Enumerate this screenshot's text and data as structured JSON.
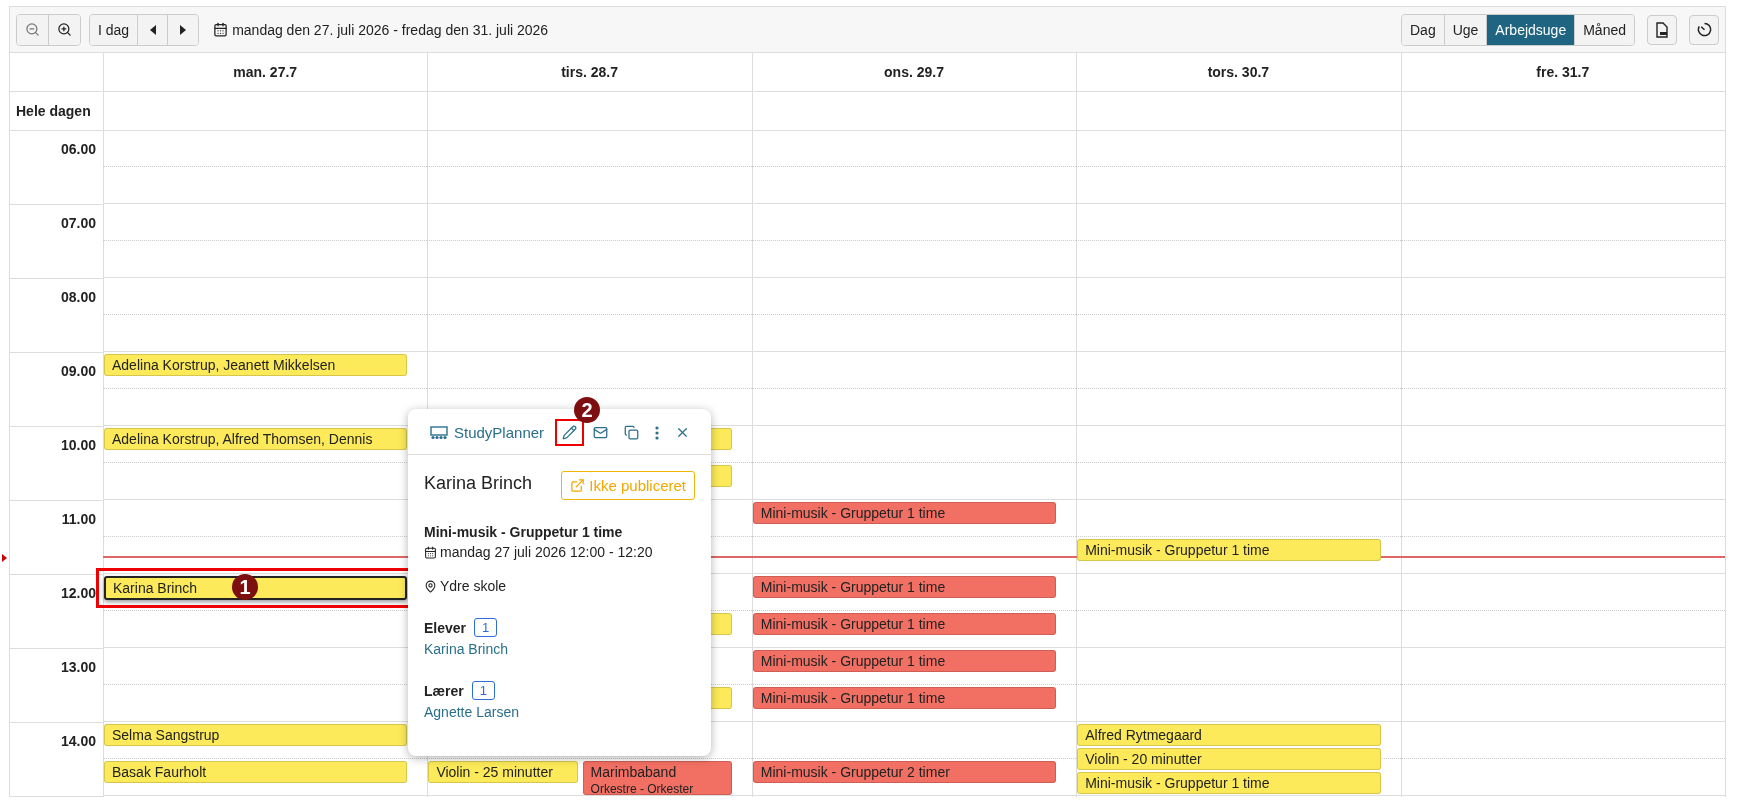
{
  "toolbar": {
    "today": "I dag",
    "range": "mandag den 27. juli 2026 - fredag den 31. juli 2026",
    "views": [
      {
        "label": "Dag",
        "selected": false
      },
      {
        "label": "Uge",
        "selected": false
      },
      {
        "label": "Arbejdsuge",
        "selected": true
      },
      {
        "label": "Måned",
        "selected": false
      }
    ]
  },
  "grid": {
    "days": [
      "man. 27.7",
      "tirs. 28.7",
      "ons. 29.7",
      "tors. 30.7",
      "fre. 31.7"
    ],
    "all_day_label": "Hele dagen",
    "hours": [
      {
        "label": "06.00",
        "halves": [
          {
            "cells": [
              {},
              {},
              {},
              {},
              {}
            ]
          },
          {
            "cells": [
              {},
              {},
              {},
              {},
              {}
            ]
          }
        ]
      },
      {
        "label": "07.00",
        "halves": [
          {
            "cells": [
              {},
              {},
              {},
              {},
              {}
            ]
          },
          {
            "cells": [
              {},
              {},
              {},
              {},
              {}
            ]
          }
        ]
      },
      {
        "label": "08.00",
        "halves": [
          {
            "cells": [
              {},
              {},
              {},
              {},
              {}
            ]
          },
          {
            "cells": [
              {},
              {},
              {},
              {},
              {}
            ]
          }
        ]
      },
      {
        "label": "09.00",
        "halves": [
          {
            "cells": [
              {
                "events": [
                  {
                    "title": "Adelina Korstrup, Jeanett Mikkelsen",
                    "color": "#fcea5a",
                    "selected": false
                  }
                ]
              },
              {},
              {},
              {},
              {}
            ]
          },
          {
            "cells": [
              {},
              {},
              {},
              {},
              {}
            ]
          }
        ]
      },
      {
        "label": "10.00",
        "halves": [
          {
            "cells": [
              {
                "events": [
                  {
                    "title": "Adelina Korstrup, Alfred Thomsen, Dennis",
                    "color": "#fcea5a",
                    "selected": false
                  }
                ]
              },
              {
                "events": [
                  {
                    "color": "#fcea5a",
                    "selected": false
                  }
                ]
              },
              {},
              {},
              {}
            ]
          },
          {
            "cells": [
              {},
              {
                "events": [
                  {
                    "color": "#fcea5a",
                    "selected": false
                  }
                ]
              },
              {},
              {},
              {}
            ]
          }
        ]
      },
      {
        "label": "11.00",
        "halves": [
          {
            "cells": [
              {},
              {},
              {
                "events": [
                  {
                    "title": "Mini-musik - Gruppetur 1 time",
                    "color": "#f26f63",
                    "selected": false
                  }
                ]
              },
              {},
              {}
            ]
          },
          {
            "now_line": true,
            "cells": [
              {},
              {},
              {},
              {
                "events": [
                  {
                    "title": "Mini-musik - Gruppetur 1 time",
                    "color": "#fcea5a",
                    "selected": false
                  }
                ]
              },
              {}
            ]
          }
        ]
      },
      {
        "label": "12.00",
        "halves": [
          {
            "cells": [
              {
                "events": [
                  {
                    "title": "Karina Brinch",
                    "color": "#fcea5a",
                    "selected": true,
                    "callout": "1"
                  }
                ]
              },
              {},
              {
                "events": [
                  {
                    "title": "Mini-musik - Gruppetur 1 time",
                    "color": "#f26f63",
                    "selected": false
                  }
                ]
              },
              {},
              {}
            ]
          },
          {
            "cells": [
              {},
              {
                "events": [
                  {
                    "color": "#fcea5a",
                    "selected": false
                  }
                ]
              },
              {
                "events": [
                  {
                    "title": "Mini-musik - Gruppetur 1 time",
                    "color": "#f26f63",
                    "selected": false
                  }
                ]
              },
              {},
              {}
            ]
          }
        ]
      },
      {
        "label": "13.00",
        "halves": [
          {
            "cells": [
              {},
              {},
              {
                "events": [
                  {
                    "title": "Mini-musik - Gruppetur 1 time",
                    "color": "#f26f63",
                    "selected": false
                  }
                ]
              },
              {},
              {}
            ]
          },
          {
            "cells": [
              {},
              {
                "events": [
                  {
                    "color": "#fcea5a",
                    "selected": false
                  }
                ]
              },
              {
                "events": [
                  {
                    "title": "Mini-musik - Gruppetur 1 time",
                    "color": "#f26f63",
                    "selected": false
                  }
                ]
              },
              {},
              {}
            ]
          }
        ]
      },
      {
        "label": "14.00",
        "halves": [
          {
            "cells": [
              {
                "events": [
                  {
                    "title": "Selma Sangstrup",
                    "color": "#fcea5a",
                    "selected": false
                  }
                ]
              },
              {},
              {},
              {
                "events": [
                  {
                    "title": "Alfred Rytmegaard",
                    "color": "#fcea5a",
                    "selected": false
                  },
                  {
                    "title": "Violin - 20 minutter",
                    "color": "#fcea5a",
                    "selected": false
                  },
                  {
                    "title": "Mini-musik - Gruppetur 1 time",
                    "color": "#fcea5a",
                    "selected": false
                  }
                ]
              },
              {}
            ]
          },
          {
            "cells": [
              {
                "events": [
                  {
                    "title": "Basak Faurholt",
                    "color": "#fcea5a",
                    "selected": false
                  }
                ]
              },
              {
                "lanes": [
                  [
                    {
                      "title": "Violin - 25 minutter",
                      "color": "#fcea5a",
                      "selected": false
                    }
                  ],
                  [
                    {
                      "title": "Marimbaband",
                      "subtitle": "Orkestre - Orkester",
                      "color": "#f26f63",
                      "selected": false
                    }
                  ]
                ]
              },
              {
                "events": [
                  {
                    "title": "Mini-musik - Gruppetur 2 timer",
                    "color": "#f26f63",
                    "selected": false
                  }
                ]
              },
              {},
              {}
            ]
          }
        ]
      }
    ]
  },
  "popup": {
    "source": "StudyPlanner",
    "actions": [
      {
        "kind": "edit",
        "callout": "2"
      },
      {
        "kind": "mail"
      },
      {
        "kind": "copy"
      },
      {
        "kind": "more"
      },
      {
        "kind": "close"
      }
    ],
    "name": "Karina Brinch",
    "status": "Ikke publiceret",
    "lesson": "Mini-musik - Gruppetur 1 time",
    "when": "mandag 27 juli 2026 12:00 - 12:20",
    "place": "Ydre skole",
    "groups": [
      {
        "label": "Elever",
        "count": "1",
        "people": [
          "Karina Brinch"
        ]
      },
      {
        "label": "Lærer",
        "count": "1",
        "people": [
          "Agnette Larsen"
        ]
      }
    ]
  }
}
